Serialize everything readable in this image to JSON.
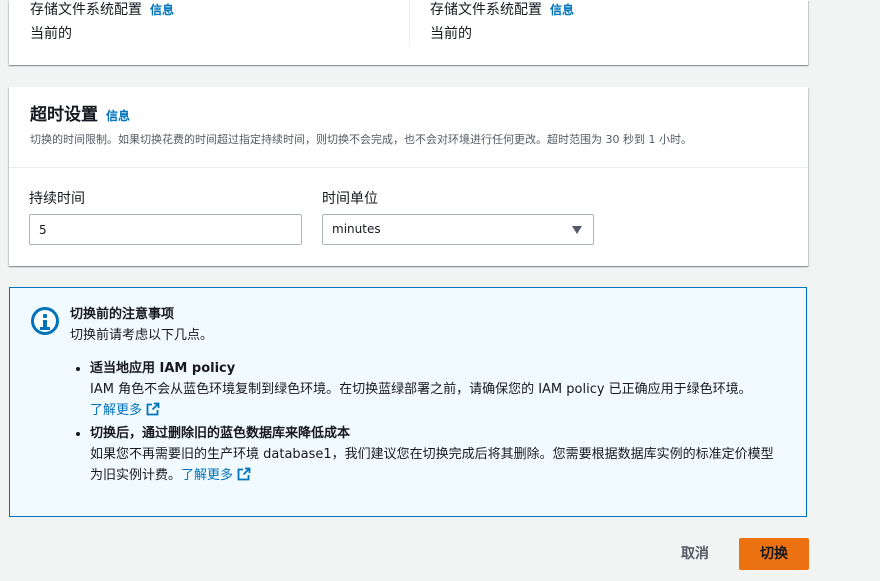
{
  "storage": {
    "left": {
      "label": "存储文件系统配置",
      "info": "信息",
      "value": "当前的"
    },
    "right": {
      "label": "存储文件系统配置",
      "info": "信息",
      "value": "当前的"
    }
  },
  "timeout": {
    "title": "超时设置",
    "info": "信息",
    "description": "切换的时间限制。如果切换花费的时间超过指定持续时间，则切换不会完成，也不会对环境进行任何更改。超时范围为 30 秒到 1 小时。",
    "duration": {
      "label": "持续时间",
      "value": "5"
    },
    "unit": {
      "label": "时间单位",
      "selected": "minutes"
    }
  },
  "alert": {
    "title": "切换前的注意事项",
    "subtitle": "切换前请考虑以下几点。",
    "items": [
      {
        "title": "适当地应用 IAM policy",
        "text": "IAM 角色不会从蓝色环境复制到绿色环境。在切换蓝绿部署之前，请确保您的 IAM policy 已正确应用于绿色环境。",
        "link": "了解更多"
      },
      {
        "title": "切换后，通过删除旧的蓝色数据库来降低成本",
        "text": "如果您不再需要旧的生产环境 database1，我们建议您在切换完成后将其删除。您需要根据数据库实例的标准定价模型为旧实例计费。",
        "link": "了解更多"
      }
    ]
  },
  "actions": {
    "cancel": "取消",
    "primary": "切换"
  },
  "colors": {
    "link": "#0073bb",
    "primary_button": "#ec7211",
    "alert_bg": "#f1faff"
  }
}
